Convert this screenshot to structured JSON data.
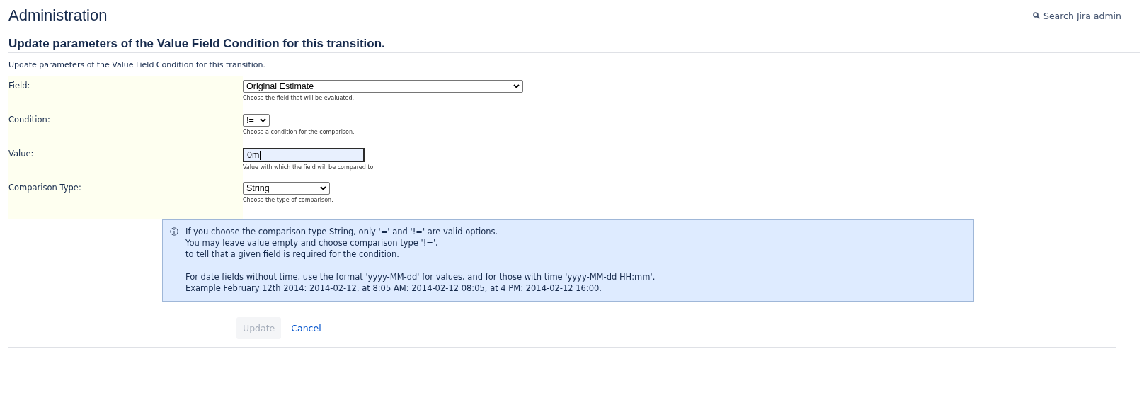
{
  "header": {
    "title": "Administration",
    "search": "Search Jira admin"
  },
  "page": {
    "heading": "Update parameters of the Value Field Condition for this transition.",
    "description": "Update parameters of the Value Field Condition for this transition."
  },
  "fields": [
    {
      "label": "Field:",
      "kind": "select",
      "value": "Original Estimate",
      "help": "Choose the field that will be evaluated."
    },
    {
      "label": "Condition:",
      "kind": "select",
      "value": "!=",
      "help": "Choose a condition for the comparison."
    },
    {
      "label": "Value:",
      "kind": "text",
      "value": "0m",
      "help": "Value with which the field will be compared to.",
      "focused": true
    },
    {
      "label": "Comparison Type:",
      "kind": "select",
      "value": "String",
      "help": "Choose the type of comparison."
    }
  ],
  "info": {
    "paragraphs": [
      [
        "If you choose the comparison type String, only '=' and '!=' are valid options.",
        "You may leave value empty and choose comparison type '!=',",
        "to tell that a given field is required for the condition."
      ],
      [
        "For date fields without time, use the format 'yyyy-MM-dd' for values, and for those with time 'yyyy-MM-dd HH:mm'.",
        "Example February 12th 2014: 2014-02-12, at 8:05 AM: 2014-02-12 08:05, at 4 PM: 2014-02-12 16:00."
      ]
    ]
  },
  "actions": {
    "submit": {
      "label": "Update",
      "disabled": true
    },
    "cancel": "Cancel"
  }
}
